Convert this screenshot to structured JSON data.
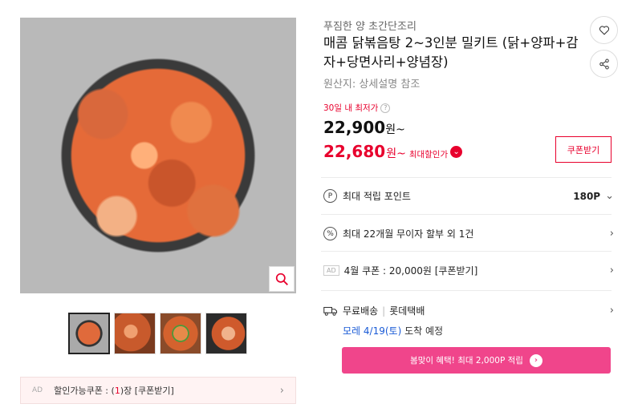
{
  "product": {
    "seller": "푸짐한 양 초간단조리",
    "title": "매콤 닭볶음탕 2~3인분 밀키트 (닭+양파+감자+당면사리+양념장)",
    "origin": "원산지: 상세설명 참조",
    "lowest_label": "30일 내 최저가",
    "price": "22,900",
    "price_unit": "원~",
    "sale_price": "22,680",
    "sale_unit": "원~",
    "sale_label": "최대할인가",
    "coupon_button": "쿠폰받기"
  },
  "gallery": {
    "thumb_count": 4,
    "ad_coupon": {
      "ad": "AD",
      "prefix": "할인가능쿠폰 : (",
      "count": "1",
      "suffix": ")장 [쿠폰받기]"
    }
  },
  "benefits": {
    "points_label": "최대 적립 포인트",
    "points_value": "180P",
    "installment_label": "최대 22개월 무이자 할부 외 1건",
    "coupon_ad": "AD",
    "coupon_label": "4월 쿠폰 : 20,000원 [쿠폰받기]"
  },
  "shipping": {
    "free": "무료배송",
    "carrier": "롯데택배",
    "arrival_highlight": "모레 4/19(토)",
    "arrival_rest": " 도착 예정"
  },
  "promo": {
    "text": "봄맞이 혜택! 최대 2,000P 적립"
  },
  "icons": {
    "zoom": "search-icon",
    "heart": "heart-icon",
    "share": "share-icon",
    "points": "point-icon",
    "installment": "percent-icon",
    "truck": "truck-icon"
  },
  "colors": {
    "accent_red": "#e8002d",
    "promo_pink": "#f0458b",
    "arrival_blue": "#1a5bd6"
  }
}
